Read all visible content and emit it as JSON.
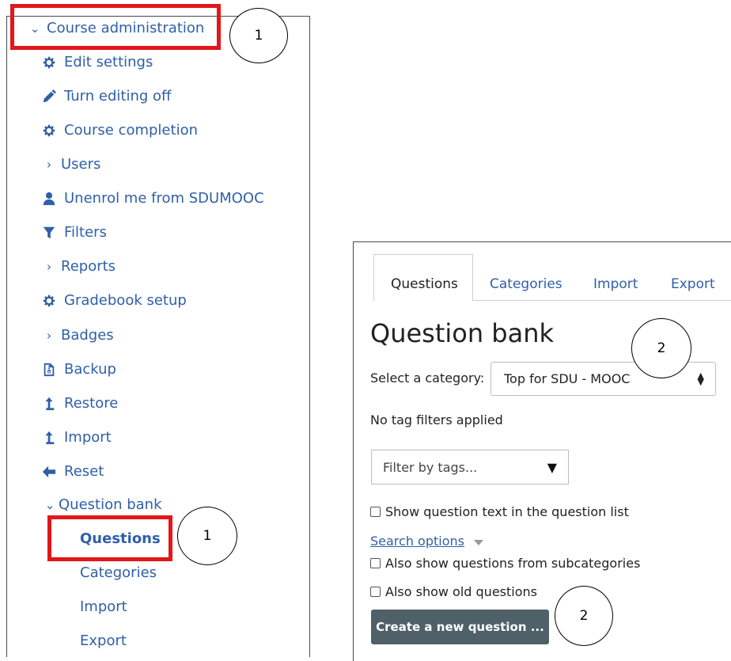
{
  "left_menu": {
    "header": "Course administration",
    "items": [
      {
        "label": "Edit settings",
        "icon": "gear-icon"
      },
      {
        "label": "Turn editing off",
        "icon": "pencil-icon"
      },
      {
        "label": "Course completion",
        "icon": "gear-icon"
      },
      {
        "label": "Users",
        "icon": "chevron-right-icon"
      },
      {
        "label": "Unenrol me from SDUMOOC",
        "icon": "user-icon"
      },
      {
        "label": "Filters",
        "icon": "filter-icon"
      },
      {
        "label": "Reports",
        "icon": "chevron-right-icon"
      },
      {
        "label": "Gradebook setup",
        "icon": "gear-icon"
      },
      {
        "label": "Badges",
        "icon": "chevron-right-icon"
      },
      {
        "label": "Backup",
        "icon": "file-archive-icon"
      },
      {
        "label": "Restore",
        "icon": "upload-arrow-icon"
      },
      {
        "label": "Import",
        "icon": "upload-arrow-icon"
      },
      {
        "label": "Reset",
        "icon": "arrow-left-icon"
      },
      {
        "label": "Question bank",
        "icon": "chevron-down-icon"
      }
    ],
    "question_bank_sub": [
      "Questions",
      "Categories",
      "Import",
      "Export"
    ]
  },
  "annotations": {
    "step1": "1",
    "step2": "2"
  },
  "right_panel": {
    "tabs": [
      "Questions",
      "Categories",
      "Import",
      "Export"
    ],
    "title": "Question bank",
    "category_label": "Select a category:",
    "category_value": "Top for SDU - MOOC",
    "no_tag_filters": "No tag filters applied",
    "filter_placeholder": "Filter by tags...",
    "show_question_text": "Show question text in the question list",
    "search_options": "Search options",
    "also_subcategories": "Also show questions from subcategories",
    "also_old": "Also show old questions",
    "create_button": "Create a new question ..."
  },
  "colors": {
    "link": "#2f5fa8",
    "highlight": "#e3161b",
    "button_bg": "#4f6068"
  }
}
